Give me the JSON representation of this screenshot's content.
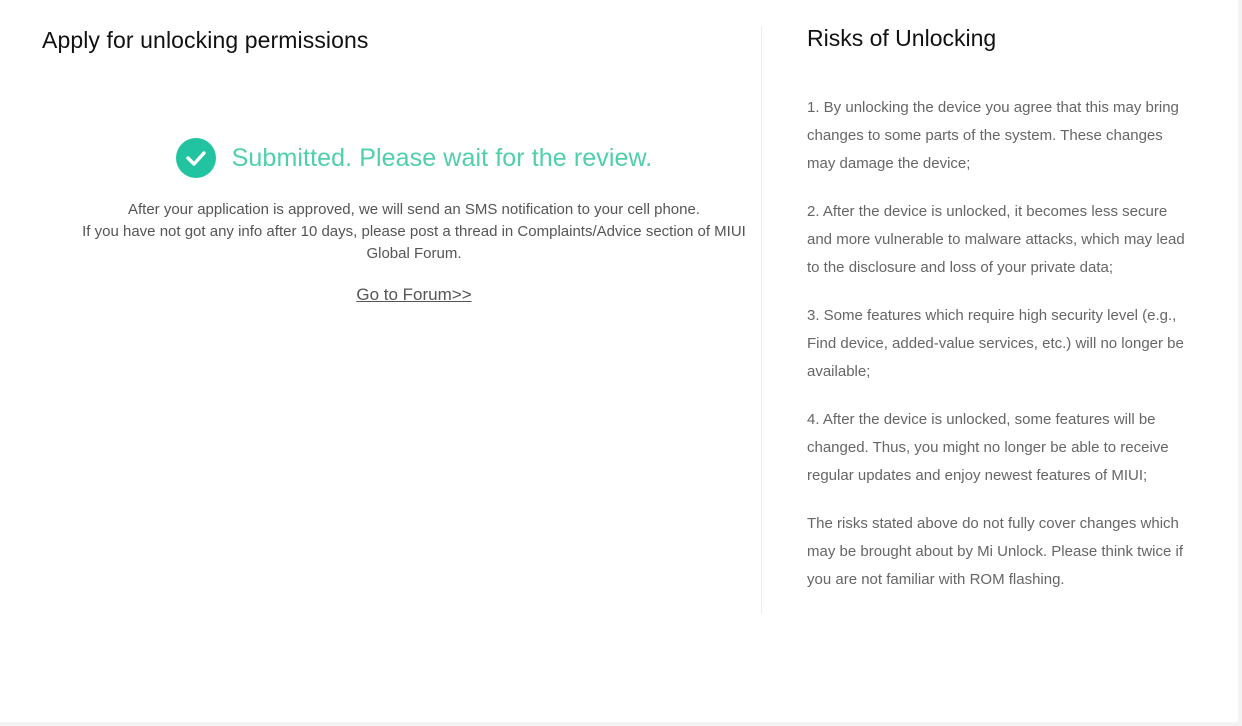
{
  "left": {
    "title": "Apply for unlocking permissions",
    "status": "Submitted. Please wait for the review.",
    "status_icon": "check-circle-icon",
    "info_line1": "After your application is approved, we will send an SMS notification to your cell phone.",
    "info_line2": "If you have not got any info after 10 days, please post a thread in Complaints/Advice section of MIUI Global Forum.",
    "forum_link": "Go to Forum>>"
  },
  "right": {
    "title": "Risks of Unlocking",
    "risks": [
      "1. By unlocking the device you agree that this may bring changes to some parts of the system. These changes may damage the device;",
      "2. After the device is unlocked, it becomes less secure and more vulnerable to malware attacks, which may lead to the disclosure and loss of your private data;",
      "3. Some features which require high security level (e.g., Find device, added-value services, etc.) will no longer be available;",
      "4. After the device is unlocked, some features will be changed. Thus, you might no longer be able to receive regular updates and enjoy newest features of MIUI;",
      "The risks stated above do not fully cover changes which may be brought about by Mi Unlock. Please think twice if you are not familiar with ROM flashing."
    ]
  },
  "colors": {
    "accent": "#21c3a0",
    "status_text": "#4fcfac"
  }
}
